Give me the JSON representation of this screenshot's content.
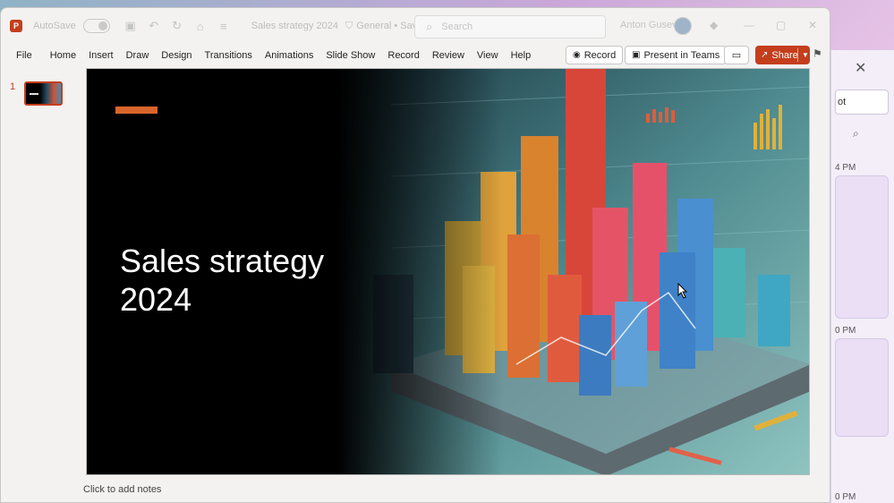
{
  "titlebar": {
    "autosave_label": "AutoSave",
    "autosave_state": "Off",
    "doc_title": "Sales strategy 2024",
    "sensitivity": "General • Saved",
    "search_placeholder": "Search",
    "user_name": "Anton Gusev"
  },
  "ribbon": {
    "tabs": [
      "File",
      "Home",
      "Insert",
      "Draw",
      "Design",
      "Transitions",
      "Animations",
      "Slide Show",
      "Record",
      "Review",
      "View",
      "Help"
    ],
    "record_label": "Record",
    "present_label": "Present in Teams",
    "share_label": "Share"
  },
  "thumbnails": {
    "slide_number": "1"
  },
  "slide": {
    "title_line1": "Sales strategy",
    "title_line2": "2024"
  },
  "notes": {
    "placeholder": "Click to add notes"
  },
  "side_panel": {
    "box_text": "ot",
    "time1": "4 PM",
    "time2": "0 PM",
    "time3": "0 PM"
  },
  "colors": {
    "accent": "#c43e1c",
    "slide_accent": "#d9652b"
  }
}
